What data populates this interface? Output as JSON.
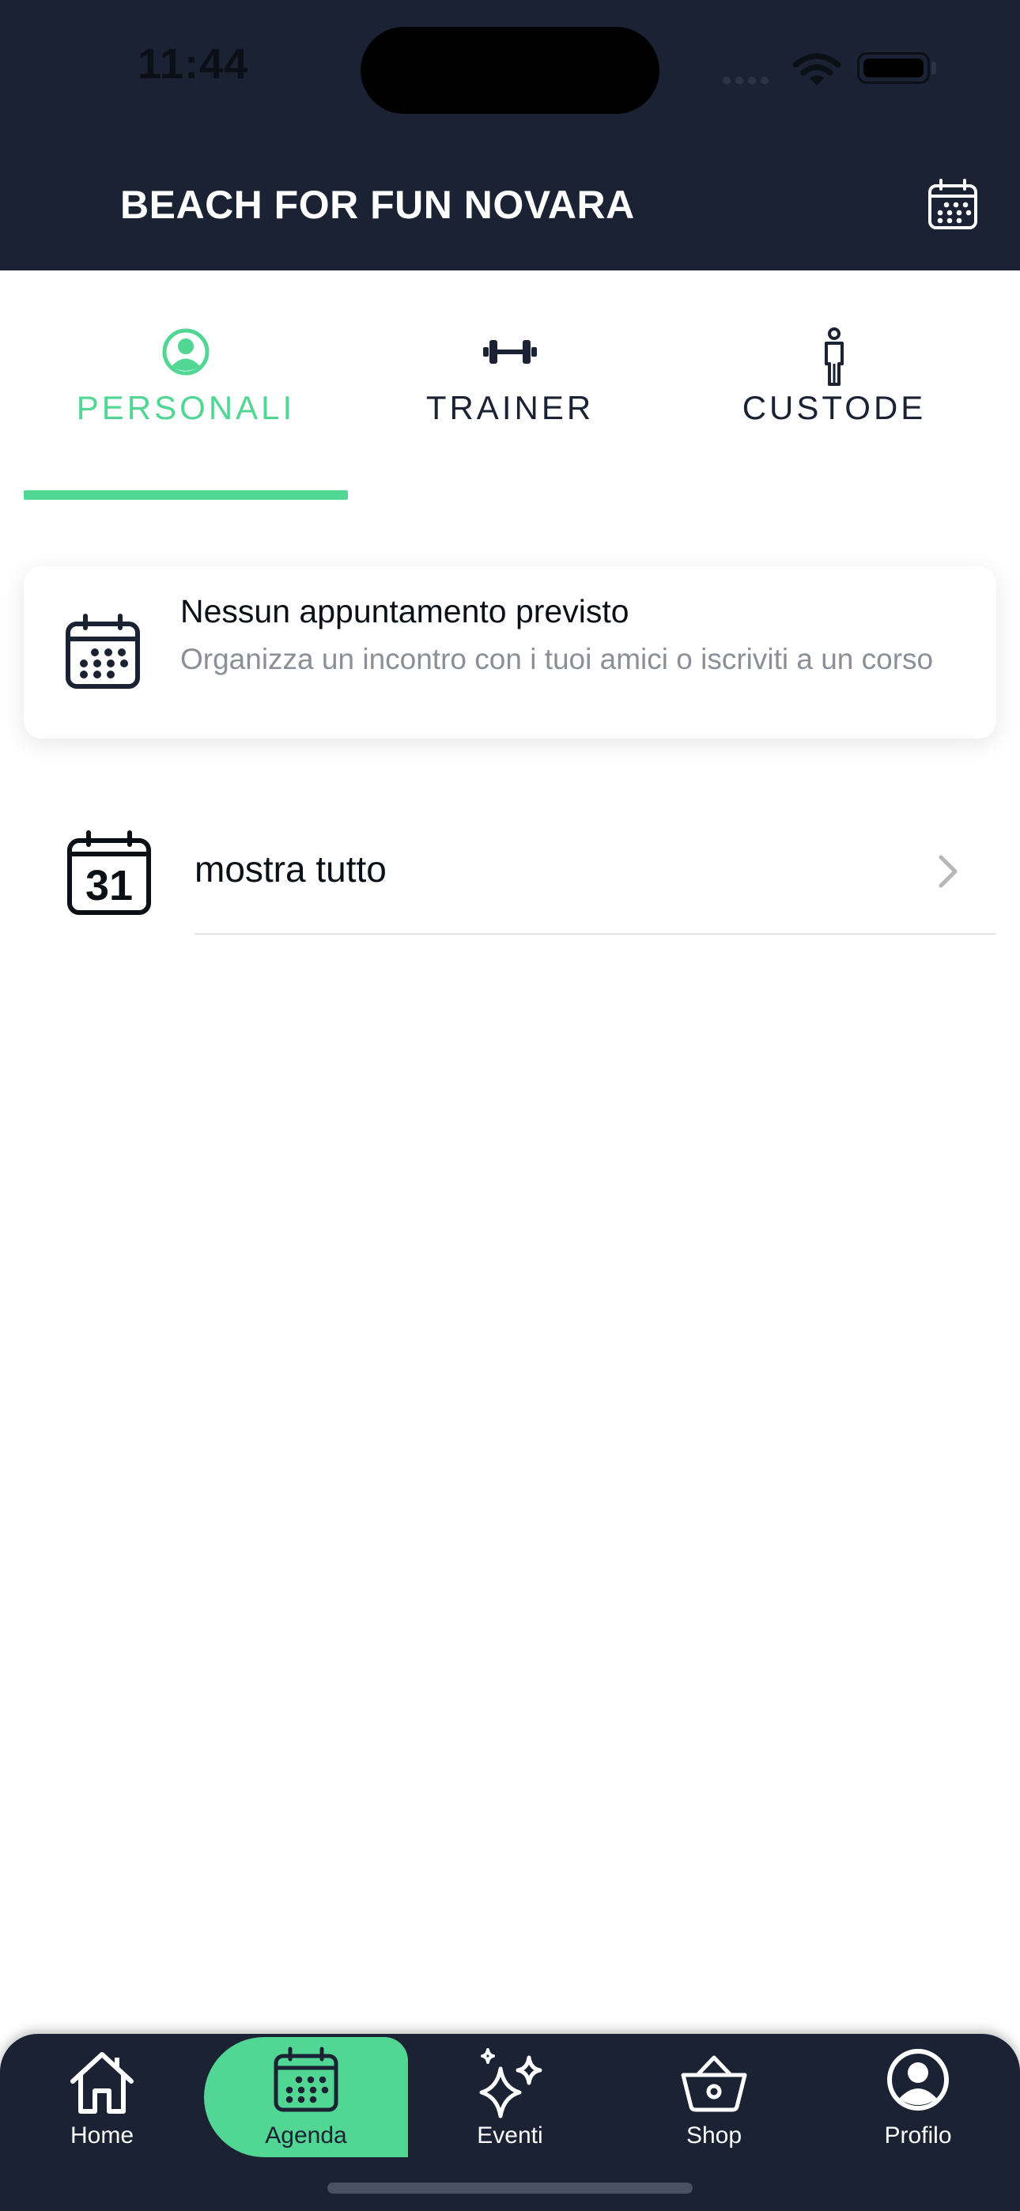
{
  "status_bar": {
    "time": "11:44"
  },
  "header": {
    "title": "BEACH FOR FUN NOVARA",
    "calendar_icon": "calendar-icon"
  },
  "tabs": [
    {
      "label": "PERSONALI",
      "icon": "person-icon",
      "active": true
    },
    {
      "label": "TRAINER",
      "icon": "dumbbell-icon",
      "active": false
    },
    {
      "label": "CUSTODE",
      "icon": "standing-person-icon",
      "active": false
    }
  ],
  "empty_card": {
    "title": "Nessun appuntamento previsto",
    "subtitle": "Organizza un incontro con i tuoi amici o iscriviti a un corso",
    "icon": "calendar-icon"
  },
  "show_all_row": {
    "label": "mostra tutto",
    "icon_text": "31",
    "icon": "calendar-31-icon"
  },
  "bottom_nav": [
    {
      "label": "Home",
      "icon": "home-icon",
      "active": false
    },
    {
      "label": "Agenda",
      "icon": "calendar-icon",
      "active": true
    },
    {
      "label": "Eventi",
      "icon": "sparkles-icon",
      "active": false
    },
    {
      "label": "Shop",
      "icon": "basket-icon",
      "active": false
    },
    {
      "label": "Profilo",
      "icon": "profile-icon",
      "active": false
    }
  ],
  "colors": {
    "navy": "#1a2233",
    "accent": "#52d694",
    "muted": "#8b8f96"
  }
}
